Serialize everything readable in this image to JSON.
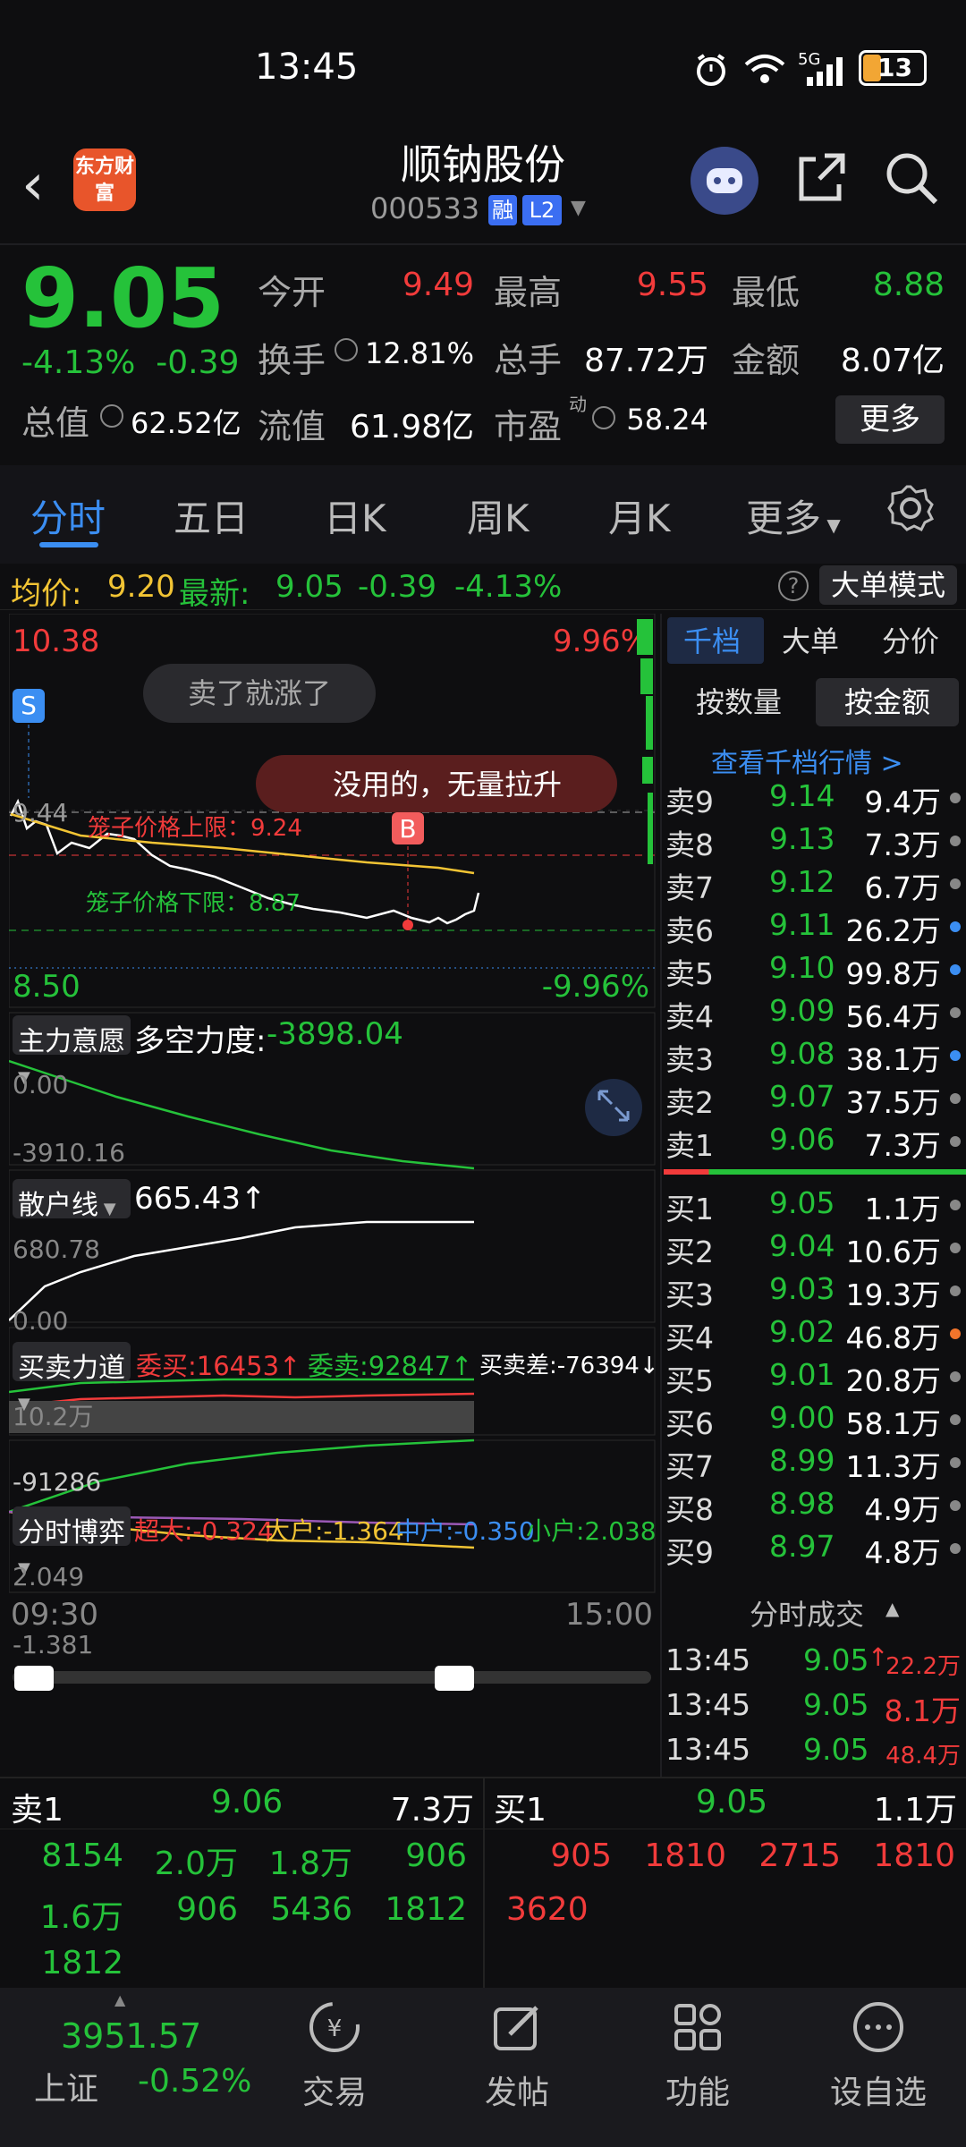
{
  "status_bar": {
    "time": "13:45",
    "battery": "13",
    "signal": "5G"
  },
  "header": {
    "title": "顺钠股份",
    "code": "000533",
    "tags": [
      "融",
      "L2"
    ],
    "logo_text": "东方财富"
  },
  "quote": {
    "price": "9.05",
    "change_pct": "-4.13%",
    "change_amt": "-0.39",
    "total_mv_label": "总值",
    "total_mv": "62.52亿",
    "fields": [
      {
        "label": "今开",
        "value": "9.49",
        "color": "red"
      },
      {
        "label": "最高",
        "value": "9.55",
        "color": "red"
      },
      {
        "label": "最低",
        "value": "8.88",
        "color": "green"
      },
      {
        "label": "换手",
        "value": "12.81%",
        "color": "white"
      },
      {
        "label": "总手",
        "value": "87.72万",
        "color": "white"
      },
      {
        "label": "金额",
        "value": "8.07亿",
        "color": "white"
      },
      {
        "label": "流值",
        "value": "61.98亿",
        "color": "white"
      },
      {
        "label": "市盈",
        "value": "58.24",
        "color": "white"
      }
    ],
    "pe_sup": "动",
    "more": "更多"
  },
  "tabs": [
    "分时",
    "五日",
    "日K",
    "周K",
    "月K",
    "更多"
  ],
  "avgbar": {
    "avg_label": "均价:",
    "avg_value": "9.20",
    "latest_label": "最新:",
    "latest_value": "9.05",
    "latest_chg": "-0.39",
    "latest_pct": "-4.13%",
    "big_order_mode": "大单模式",
    "help": "?"
  },
  "main_chart": {
    "high_price": "10.38",
    "high_pct": "9.96%",
    "low_price": "8.50",
    "low_pct": "-9.96%",
    "bubble1": "卖了就涨了",
    "bubble2": "没用的，无量拉升",
    "cage_upper": "笼子价格上限：9.24",
    "cage_lower": "笼子价格下限：8.87",
    "marker_s": "S",
    "marker_b": "B",
    "open_label": "9.44"
  },
  "indicator1": {
    "selector": "主力意愿",
    "name": "多空力度:",
    "value": "-3898.04",
    "top": "0.00",
    "bottom": "-3910.16"
  },
  "indicator2": {
    "selector": "散户线",
    "value": "665.43↑",
    "top": "680.78",
    "bottom": "0.00"
  },
  "indicator3": {
    "selector": "买卖力道",
    "buy": "委买:16453↑",
    "sell": "委卖:92847↑",
    "diff": "买卖差:-76394↓",
    "top": "10.2万",
    "bottom": "-91286"
  },
  "indicator4": {
    "selector": "分时博弈",
    "super": "超大:-0.324",
    "large": "大户:-1.364",
    "mid": "中户:-0.350",
    "small": "小户:2.038",
    "top": "2.049",
    "bottom": "-1.381"
  },
  "time_axis": {
    "start": "09:30",
    "end": "15:00"
  },
  "orderbook": {
    "tabs": [
      "千档",
      "大单",
      "分价"
    ],
    "subtabs": [
      "按数量",
      "按金额"
    ],
    "link": "查看千档行情 >",
    "asks": [
      {
        "label": "卖9",
        "price": "9.14",
        "vol": "9.4万",
        "dot": "#888888"
      },
      {
        "label": "卖8",
        "price": "9.13",
        "vol": "7.3万",
        "dot": "#888888"
      },
      {
        "label": "卖7",
        "price": "9.12",
        "vol": "6.7万",
        "dot": "#888888"
      },
      {
        "label": "卖6",
        "price": "9.11",
        "vol": "26.2万",
        "dot": "#3b8ef2"
      },
      {
        "label": "卖5",
        "price": "9.10",
        "vol": "99.8万",
        "dot": "#3b8ef2"
      },
      {
        "label": "卖4",
        "price": "9.09",
        "vol": "56.4万",
        "dot": "#888888"
      },
      {
        "label": "卖3",
        "price": "9.08",
        "vol": "38.1万",
        "dot": "#3b8ef2"
      },
      {
        "label": "卖2",
        "price": "9.07",
        "vol": "37.5万",
        "dot": "#888888"
      },
      {
        "label": "卖1",
        "price": "9.06",
        "vol": "7.3万",
        "dot": "#888888"
      }
    ],
    "bids": [
      {
        "label": "买1",
        "price": "9.05",
        "vol": "1.1万",
        "dot": "#888888"
      },
      {
        "label": "买2",
        "price": "9.04",
        "vol": "10.6万",
        "dot": "#888888"
      },
      {
        "label": "买3",
        "price": "9.03",
        "vol": "19.3万",
        "dot": "#888888"
      },
      {
        "label": "买4",
        "price": "9.02",
        "vol": "46.8万",
        "dot": "#f2742b"
      },
      {
        "label": "买5",
        "price": "9.01",
        "vol": "20.8万",
        "dot": "#888888"
      },
      {
        "label": "买6",
        "price": "9.00",
        "vol": "58.1万",
        "dot": "#888888"
      },
      {
        "label": "买7",
        "price": "8.99",
        "vol": "11.3万",
        "dot": "#888888"
      },
      {
        "label": "买8",
        "price": "8.98",
        "vol": "4.9万",
        "dot": "#888888"
      },
      {
        "label": "买9",
        "price": "8.97",
        "vol": "4.8万",
        "dot": "#888888"
      }
    ],
    "trades_title": "分时成交",
    "trades": [
      {
        "time": "13:45",
        "price": "9.05",
        "vol": "22.2万",
        "arrow": "↑"
      },
      {
        "time": "13:45",
        "price": "9.05",
        "vol": "8.1万",
        "arrow": ""
      },
      {
        "time": "13:45",
        "price": "9.05",
        "vol": "48.4万",
        "arrow": ""
      }
    ]
  },
  "bottom_panel": {
    "sell1_label": "卖1",
    "sell1_price": "9.06",
    "sell1_vol": "7.3万",
    "buy1_label": "买1",
    "buy1_price": "9.05",
    "buy1_vol": "1.1万",
    "sell_queue": [
      "8154",
      "2.0万",
      "1.8万",
      "906",
      "1.6万",
      "906",
      "5436",
      "1812",
      "1812"
    ],
    "buy_queue": [
      "905",
      "1810",
      "2715",
      "1810",
      "3620"
    ]
  },
  "nav": {
    "index_value": "3951.57",
    "index_name": "上证",
    "index_pct": "-0.52%",
    "items": [
      "交易",
      "发帖",
      "功能",
      "设自选"
    ]
  }
}
